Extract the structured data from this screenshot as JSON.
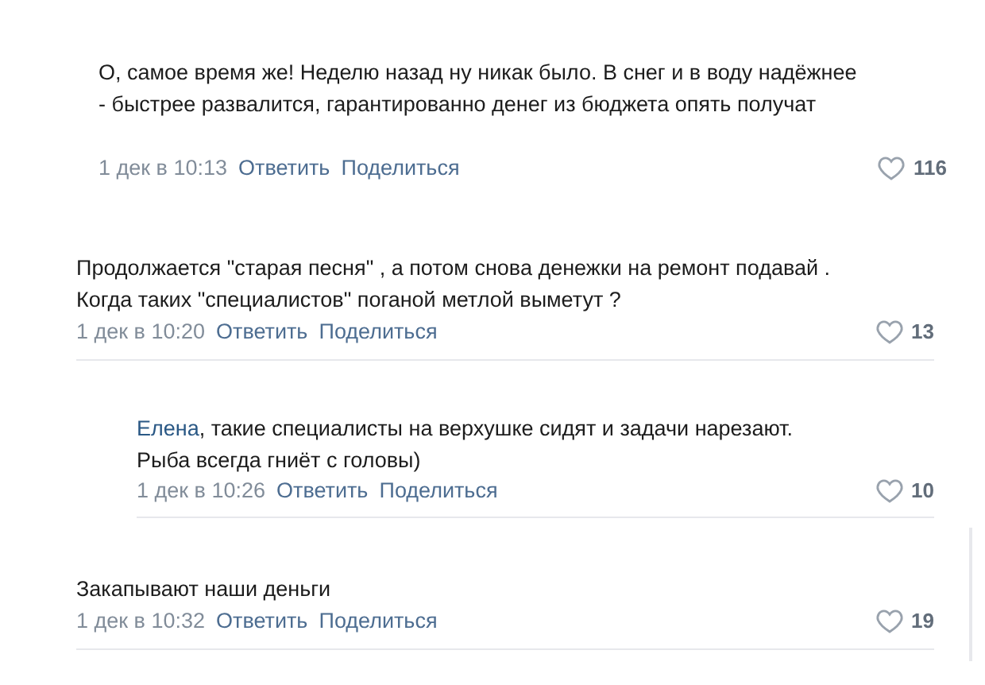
{
  "comments": [
    {
      "kind": "reply",
      "text": "О, самое время же! Неделю назад ну никак было. В снег и в воду надёжнее - быстрее развалится, гарантированно денег из бюджета опять получат",
      "date": "1 дек в 10:13",
      "reply": "Ответить",
      "share": "Поделиться",
      "likes": "116",
      "divider": false
    },
    {
      "kind": "top",
      "text": "Продолжается \"старая песня\" , а потом снова денежки на ремонт подавай . Когда таких \"специалистов\" поганой метлой выметут ?",
      "date": "1 дек в 10:20",
      "reply": "Ответить",
      "share": "Поделиться",
      "likes": "13",
      "divider": true,
      "children": [
        {
          "mention": "Елена",
          "text": ", такие специалисты на верхушке сидят и задачи нарезают. Рыба всегда гниёт с головы)",
          "date": "1 дек в 10:26",
          "reply": "Ответить",
          "share": "Поделиться",
          "likes": "10",
          "divider": true
        }
      ]
    },
    {
      "kind": "top",
      "text": "Закапывают наши деньги",
      "date": "1 дек в 10:32",
      "reply": "Ответить",
      "share": "Поделиться",
      "likes": "19",
      "divider": true
    }
  ]
}
